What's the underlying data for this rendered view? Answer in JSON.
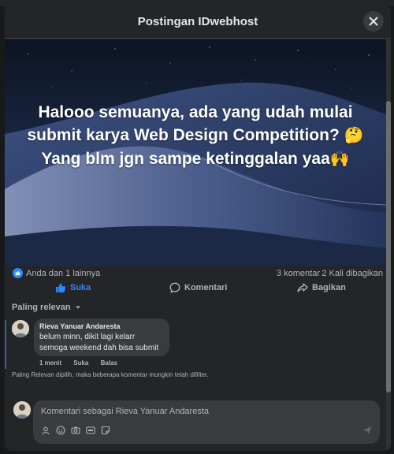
{
  "modal": {
    "title": "Postingan IDwebhost",
    "close_icon": "close-icon"
  },
  "post": {
    "text_line1": "Halooo semuanya, ada yang udah mulai",
    "text_line2": "submit karya Web Design Competition?",
    "text_line3": "Yang blm jgn sampe ketinggalan yaa",
    "emoji1": "🤔",
    "emoji2": "🙌"
  },
  "stats": {
    "reactions": "Anda dan 1 lainnya",
    "comments": "3 komentar",
    "shares": "2 Kali dibagikan"
  },
  "actions": {
    "like": "Suka",
    "comment": "Komentari",
    "share": "Bagikan"
  },
  "sort": {
    "label": "Paling relevan"
  },
  "comment": {
    "author": "Rieva Yanuar Andaresta",
    "line1": "belum minn, dikit lagi kelarr",
    "line2": "semoga weekend dah bisa submit",
    "time": "1 menit",
    "like": "Suka",
    "reply": "Balas"
  },
  "filter_note": "Paling Relevan dipilih, maka beberapa komentar mungkin telah difilter.",
  "composer": {
    "placeholder": "Komentari sebagai Rieva Yanuar Andaresta"
  },
  "colors": {
    "accent": "#2d88ff",
    "surface": "#242526",
    "bubble": "#3a3b3c"
  }
}
